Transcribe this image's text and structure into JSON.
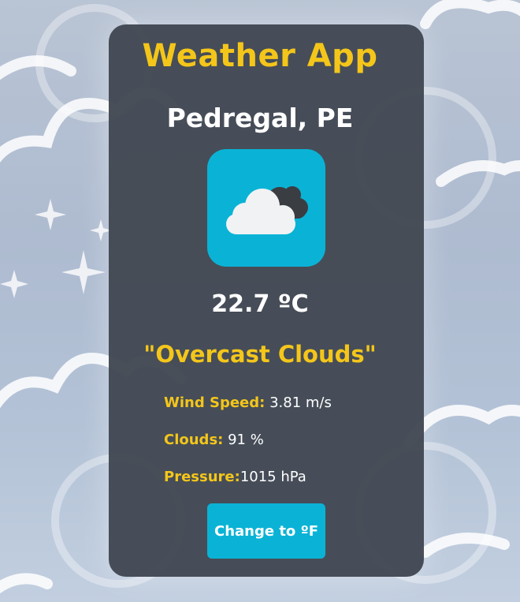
{
  "app": {
    "title": "Weather App"
  },
  "location": {
    "city": "Pedregal, PE"
  },
  "weather": {
    "icon": "cloud-icon",
    "temperature": "22.7 ºC",
    "description": "\"Overcast Clouds\""
  },
  "details": {
    "wind_label": "Wind Speed:",
    "wind_value": "3.81 m/s",
    "clouds_label": "Clouds:",
    "clouds_value": "91 %",
    "pressure_label": "Pressure:",
    "pressure_value": "1015 hPa"
  },
  "actions": {
    "toggle_unit_label": "Change to ºF"
  },
  "colors": {
    "accent": "#f4c61a",
    "icon_bg": "#0ab3d6",
    "card_bg": "#424852"
  }
}
